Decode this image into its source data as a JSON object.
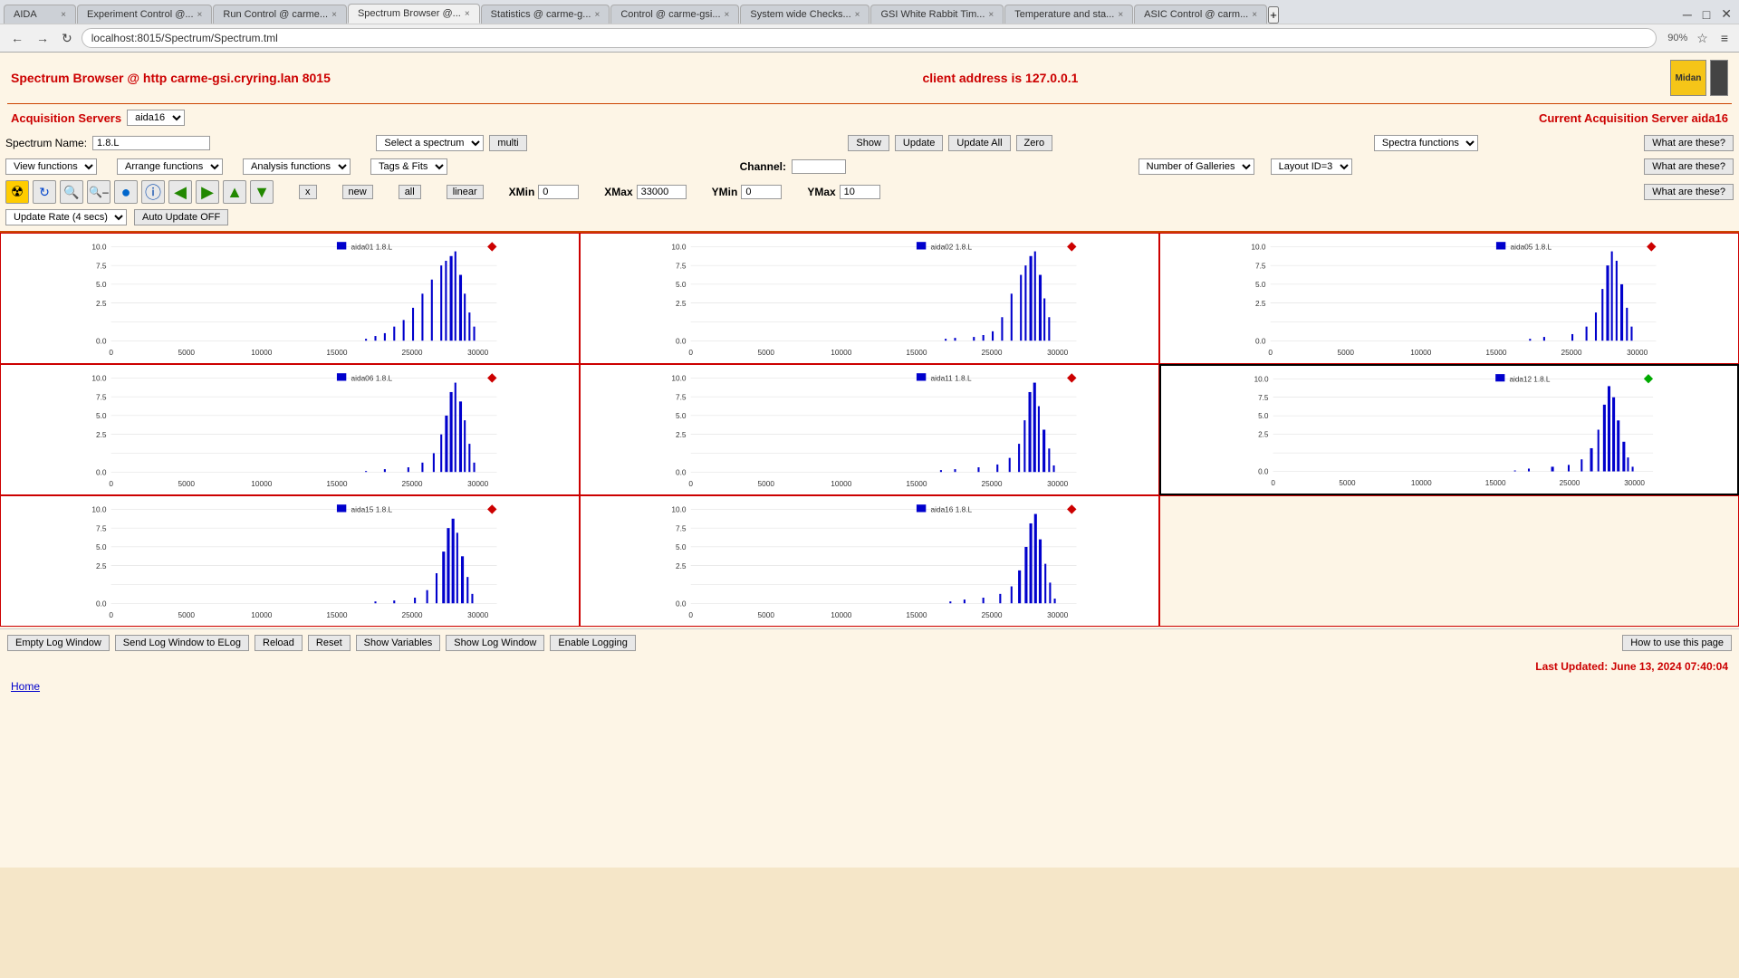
{
  "browser": {
    "tabs": [
      {
        "label": "AIDA",
        "active": false,
        "closeable": true
      },
      {
        "label": "Experiment Control @...",
        "active": false,
        "closeable": true
      },
      {
        "label": "Run Control @ carme...",
        "active": false,
        "closeable": true
      },
      {
        "label": "Spectrum Browser @...",
        "active": true,
        "closeable": true
      },
      {
        "label": "Statistics @ carme-g...",
        "active": false,
        "closeable": true
      },
      {
        "label": "Control @ carme-gsi...",
        "active": false,
        "closeable": true
      },
      {
        "label": "System wide Checks...",
        "active": false,
        "closeable": true
      },
      {
        "label": "GSI White Rabbit Tim...",
        "active": false,
        "closeable": true
      },
      {
        "label": "Temperature and sta...",
        "active": false,
        "closeable": true
      },
      {
        "label": "ASIC Control @ carm...",
        "active": false,
        "closeable": true
      }
    ],
    "address": "localhost:8015/Spectrum/Spectrum.tml",
    "zoom": "90%"
  },
  "header": {
    "title": "Spectrum Browser @ http carme-gsi.cryring.lan 8015",
    "client_address": "client address is 127.0.0.1"
  },
  "acquisition": {
    "servers_label": "Acquisition Servers",
    "servers_value": "aida16",
    "current_label": "Current Acquisition Server aida16"
  },
  "controls": {
    "spectrum_name_label": "Spectrum Name:",
    "spectrum_name_value": "1.8.L",
    "select_spectrum_label": "Select a spectrum",
    "multi_label": "multi",
    "show_label": "Show",
    "update_label": "Update",
    "update_all_label": "Update All",
    "zero_label": "Zero",
    "spectra_functions_label": "Spectra functions",
    "what_these_1": "What are these?",
    "view_functions_label": "View functions",
    "arrange_functions_label": "Arrange functions",
    "analysis_functions_label": "Analysis functions",
    "tags_fits_label": "Tags & Fits",
    "channel_label": "Channel:",
    "channel_value": "",
    "number_galleries_label": "Number of Galleries",
    "layout_id_label": "Layout ID=3",
    "what_these_2": "What are these?",
    "x_btn": "x",
    "new_btn": "new",
    "all_btn": "all",
    "linear_btn": "linear",
    "xmin_label": "XMin",
    "xmin_value": "0",
    "xmax_label": "XMax",
    "xmax_value": "33000",
    "ymin_label": "YMin",
    "ymin_value": "0",
    "ymax_label": "YMax",
    "ymax_value": "10",
    "what_these_3": "What are these?",
    "update_rate_label": "Update Rate (4 secs)",
    "auto_update_label": "Auto Update OFF"
  },
  "charts": [
    {
      "id": "aida01",
      "title": "aida01 1.8.L",
      "diamond": "red",
      "highlighted": false
    },
    {
      "id": "aida02",
      "title": "aida02 1.8.L",
      "diamond": "red",
      "highlighted": false
    },
    {
      "id": "aida05",
      "title": "aida05 1.8.L",
      "diamond": "red",
      "highlighted": false
    },
    {
      "id": "aida06",
      "title": "aida06 1.8.L",
      "diamond": "red",
      "highlighted": false
    },
    {
      "id": "aida11",
      "title": "aida11 1.8.L",
      "diamond": "red",
      "highlighted": false
    },
    {
      "id": "aida12",
      "title": "aida12 1.8.L",
      "diamond": "green",
      "highlighted": true
    },
    {
      "id": "aida15",
      "title": "aida15 1.8.L",
      "diamond": "red",
      "highlighted": false
    },
    {
      "id": "aida16",
      "title": "aida16 1.8.L",
      "diamond": "red",
      "highlighted": false
    },
    {
      "id": "empty",
      "title": "",
      "diamond": "none",
      "highlighted": false
    }
  ],
  "bottom_buttons": [
    "Empty Log Window",
    "Send Log Window to ELog",
    "Reload",
    "Reset",
    "Show Variables",
    "Show Log Window",
    "Enable Logging"
  ],
  "how_to": "How to use this page",
  "last_updated": "Last Updated: June 13, 2024 07:40:04",
  "home_link": "Home"
}
